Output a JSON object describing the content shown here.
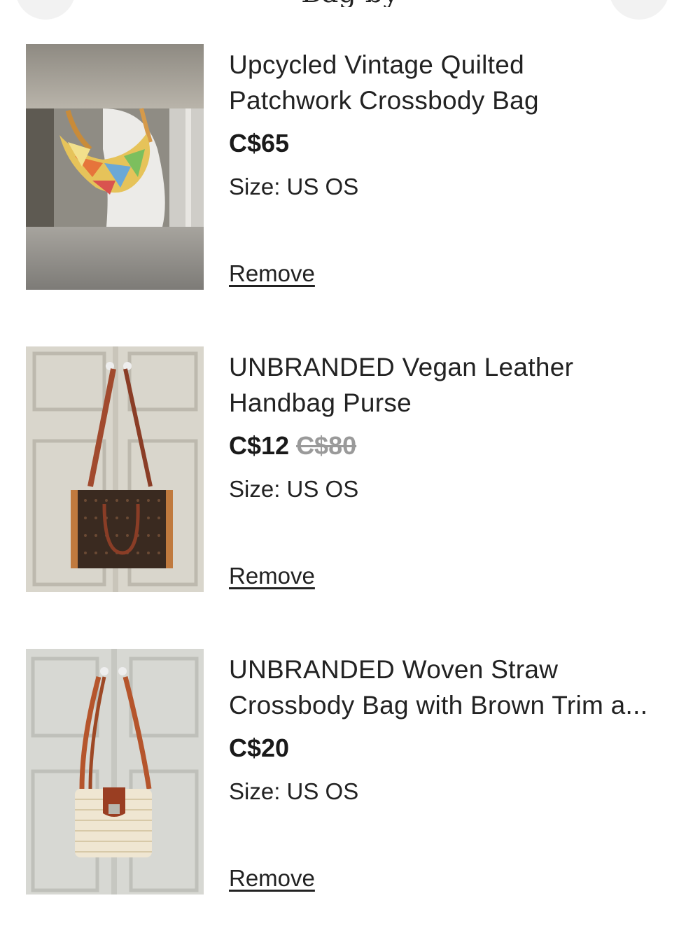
{
  "header": {
    "title": "Bag by"
  },
  "items": [
    {
      "title_line1": "Upcycled Vintage Quilted",
      "title_line2": "Patchwork Crossbody Bag",
      "price": "C$65",
      "original_price": "",
      "size": "Size: US OS",
      "remove_label": "Remove",
      "image_icon": "patchwork-crossbody-bag-photo"
    },
    {
      "title_line1": "UNBRANDED Vegan Leather",
      "title_line2": "Handbag Purse",
      "price": "C$12",
      "original_price": "C$80",
      "size": "Size: US OS",
      "remove_label": "Remove",
      "image_icon": "vegan-leather-handbag-photo"
    },
    {
      "title_line1": "UNBRANDED Woven Straw",
      "title_line2": "Crossbody Bag with Brown Trim a...",
      "price": "C$20",
      "original_price": "",
      "size": "Size: US OS",
      "remove_label": "Remove",
      "image_icon": "woven-straw-crossbody-bag-photo"
    }
  ],
  "colors": {
    "text": "#222222",
    "strike_price": "#9a9a9a",
    "background": "#ffffff"
  }
}
